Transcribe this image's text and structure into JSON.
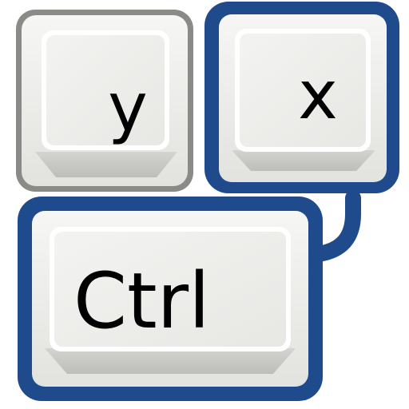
{
  "keys": {
    "y": {
      "label": "y",
      "highlighted": false
    },
    "x": {
      "label": "x",
      "highlighted": true
    },
    "ctrl": {
      "label": "Ctrl",
      "highlighted": true
    }
  },
  "colors": {
    "highlight_border": "#1f4a8c",
    "normal_border": "#8a8a86",
    "key_face": "#eeeeec",
    "key_shadow": "#c6c7c3",
    "label": "#000000"
  },
  "icons": {
    "link": "connector-icon"
  }
}
